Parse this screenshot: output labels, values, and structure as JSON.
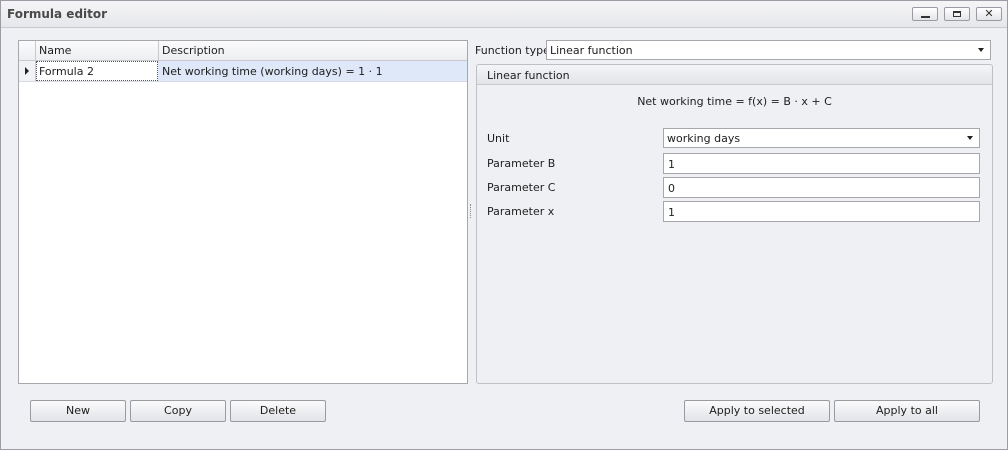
{
  "window": {
    "title": "Formula editor"
  },
  "grid": {
    "columns": [
      "Name",
      "Description"
    ],
    "rows": [
      {
        "name": "Formula 2",
        "description": "Net working time (working days) = 1 · 1"
      }
    ]
  },
  "function_type": {
    "label": "Function type",
    "value": "Linear function"
  },
  "group": {
    "title": "Linear function",
    "formula": "Net working time = f(x) = B · x + C",
    "unit": {
      "label": "Unit",
      "value": "working days"
    },
    "param_b": {
      "label": "Parameter B",
      "value": "1"
    },
    "param_c": {
      "label": "Parameter C",
      "value": "0"
    },
    "param_x": {
      "label": "Parameter x",
      "value": "1"
    }
  },
  "buttons": {
    "new": "New",
    "copy": "Copy",
    "delete": "Delete",
    "apply_selected": "Apply to selected",
    "apply_all": "Apply to all"
  },
  "icons": {
    "minimize": "minimize-icon",
    "maximize": "maximize-icon",
    "close": "close-icon",
    "row-indicator": "row-pointer-icon"
  }
}
